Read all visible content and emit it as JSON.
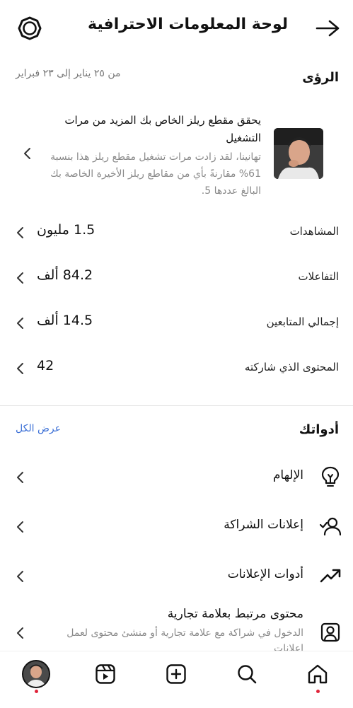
{
  "header": {
    "title": "لوحة المعلومات الاحترافية"
  },
  "insights": {
    "title": "الرؤى",
    "date_range": "من ٢٥ يناير إلى ٢٣ فبراير",
    "card": {
      "title": "يحقق مقطع ريلز الخاص بك المزيد من مرات التشغيل",
      "body": "تهانينا، لقد زادت مرات تشغيل مقطع ريلز هذا بنسبة 61% مقارنةً بأي من مقاطع ريلز الأخيرة الخاصة بك البالغ عددها 5."
    },
    "metrics": [
      {
        "label": "المشاهدات",
        "value": "1.5 مليون"
      },
      {
        "label": "التفاعلات",
        "value": "84.2 ألف"
      },
      {
        "label": "إجمالي المتابعين",
        "value": "14.5 ألف"
      },
      {
        "label": "المحتوى الذي شاركته",
        "value": "42"
      }
    ]
  },
  "tools": {
    "title": "أدواتك",
    "see_all": "عرض الكل",
    "items": [
      {
        "label": "الإلهام",
        "icon": "lightbulb-icon"
      },
      {
        "label": "إعلانات الشراكة",
        "icon": "partnership-icon"
      },
      {
        "label": "أدوات الإعلانات",
        "icon": "trending-up-icon"
      }
    ],
    "branded": {
      "title": "محتوى مرتبط بعلامة تجارية",
      "desc": "الدخول في شراكة مع علامة تجارية أو منشئ محتوى لعمل إعلانات",
      "icon": "branded-content-icon"
    }
  },
  "bottom_nav": [
    "home-icon",
    "search-icon",
    "create-icon",
    "reels-icon",
    "profile-avatar"
  ],
  "colors": {
    "link": "#3b6fd6",
    "notification_dot": "#e0243a",
    "secondary_text": "#8a8a8a"
  }
}
